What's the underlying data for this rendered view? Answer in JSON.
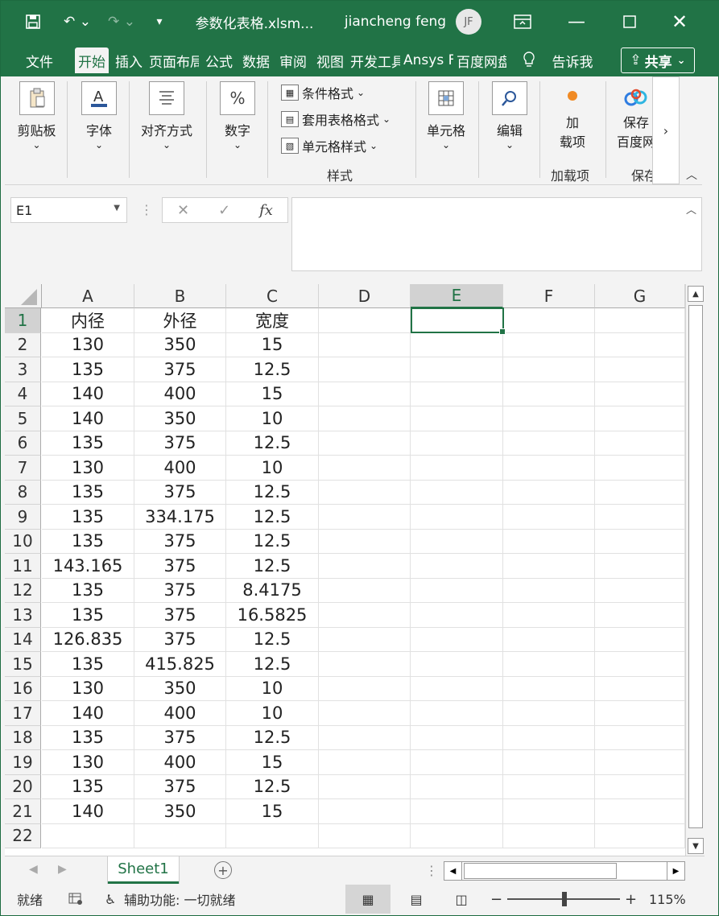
{
  "titlebar": {
    "filename": "参数化表格.xlsm...",
    "user": "jiancheng feng",
    "avatar": "JF"
  },
  "tabs": [
    "文件",
    "开始",
    "插入",
    "页面布局",
    "公式",
    "数据",
    "审阅",
    "视图",
    "开发工具",
    "Ansys Form",
    "百度网盘"
  ],
  "tellme": "告诉我",
  "share": "共享",
  "ribbon": {
    "clipboard": "剪贴板",
    "font": "字体",
    "align": "对齐方式",
    "number": "数字",
    "cond_format": "条件格式",
    "table_format": "套用表格格式",
    "cell_style": "单元格样式",
    "styles_group": "样式",
    "cells": "单元格",
    "editing": "编辑",
    "addin_1": "加",
    "addin_2": "载项",
    "addins_group": "加载项",
    "save_1": "保存",
    "save_2": "百度网",
    "save_group": "保存"
  },
  "namebox": "E1",
  "fx": "fx",
  "columns": [
    "A",
    "B",
    "C",
    "D",
    "E",
    "F",
    "G"
  ],
  "rows": [
    [
      "内径",
      "外径",
      "宽度"
    ],
    [
      "130",
      "350",
      "15"
    ],
    [
      "135",
      "375",
      "12.5"
    ],
    [
      "140",
      "400",
      "15"
    ],
    [
      "140",
      "350",
      "10"
    ],
    [
      "135",
      "375",
      "12.5"
    ],
    [
      "130",
      "400",
      "10"
    ],
    [
      "135",
      "375",
      "12.5"
    ],
    [
      "135",
      "334.175",
      "12.5"
    ],
    [
      "135",
      "375",
      "12.5"
    ],
    [
      "143.165",
      "375",
      "12.5"
    ],
    [
      "135",
      "375",
      "8.4175"
    ],
    [
      "135",
      "375",
      "16.5825"
    ],
    [
      "126.835",
      "375",
      "12.5"
    ],
    [
      "135",
      "415.825",
      "12.5"
    ],
    [
      "130",
      "350",
      "10"
    ],
    [
      "140",
      "400",
      "10"
    ],
    [
      "135",
      "375",
      "12.5"
    ],
    [
      "130",
      "400",
      "15"
    ],
    [
      "135",
      "375",
      "12.5"
    ],
    [
      "140",
      "350",
      "15"
    ],
    [
      "",
      "",
      ""
    ]
  ],
  "sheet": "Sheet1",
  "status": {
    "ready": "就绪",
    "accessibility": "辅助功能: 一切就绪",
    "zoom": "115%"
  },
  "colors": {
    "accent": "#217346"
  }
}
